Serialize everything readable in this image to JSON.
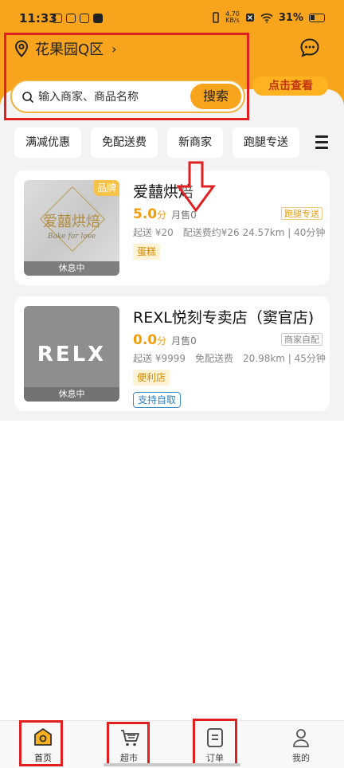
{
  "status_bar": {
    "time": "11:33",
    "net_speed_value": "4.70",
    "net_speed_unit": "KB/s",
    "battery": "31%"
  },
  "header": {
    "location": "花果园Q区",
    "promo": "点击查看"
  },
  "search": {
    "placeholder": "输入商家、商品名称",
    "button": "搜索"
  },
  "filters": [
    "满减优惠",
    "免配送费",
    "新商家",
    "跑腿专送"
  ],
  "shops": [
    {
      "name": "爱囍烘焙",
      "logo_text": "爱囍烘焙",
      "logo_sub": "Bake for love",
      "badge": "品牌",
      "status": "休息中",
      "rating": "5.0",
      "rating_unit": "分",
      "monthly_sales": "月售0",
      "delivery_type": "跑腿专送",
      "details": "起送 ¥20　配送费约¥26 24.57km | 40分钟",
      "category": "蛋糕"
    },
    {
      "name": "REXL悦刻专卖店（窦官店)",
      "logo_text": "RELX",
      "status": "休息中",
      "rating": "0.0",
      "rating_unit": "分",
      "monthly_sales": "月售0",
      "delivery_type": "商家自配",
      "details": "起送 ¥9999　免配送费　20.98km | 45分钟",
      "category": "便利店",
      "tag": "支持自取"
    }
  ],
  "bottom_nav": [
    {
      "label": "首页",
      "icon": "home-icon"
    },
    {
      "label": "超市",
      "icon": "cart-icon"
    },
    {
      "label": "订单",
      "icon": "order-icon"
    },
    {
      "label": "我的",
      "icon": "profile-icon"
    }
  ],
  "colors": {
    "accent": "#f9a41d",
    "highlight": "#e02020",
    "rating": "#f29e0c"
  }
}
